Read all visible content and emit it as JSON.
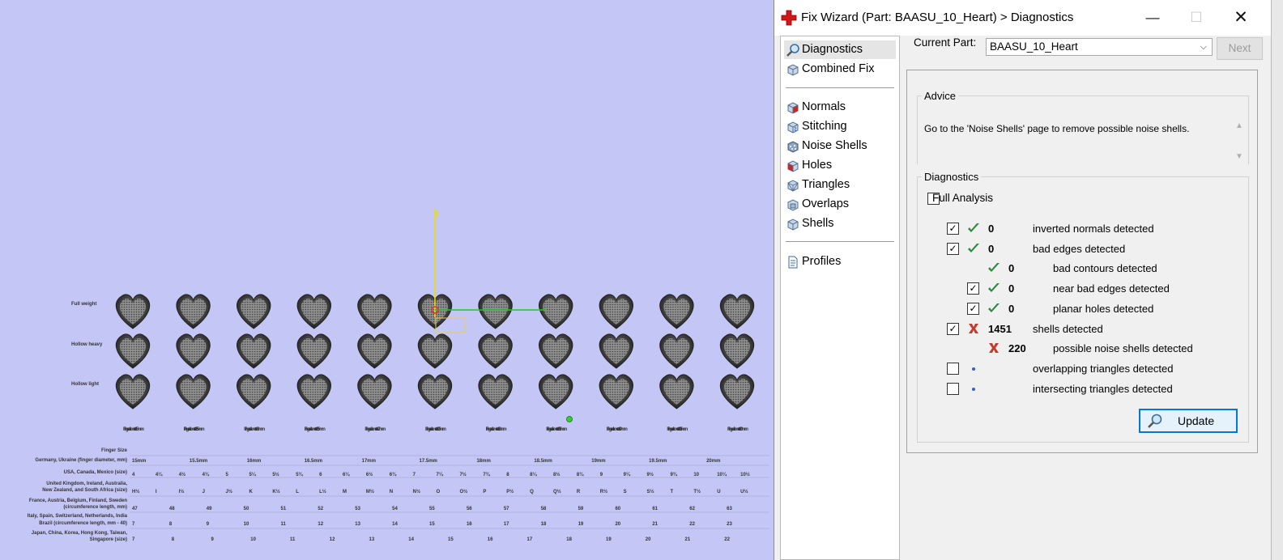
{
  "window": {
    "title": "Fix Wizard (Part: BAASU_10_Heart) > Diagnostics",
    "controls": {
      "minimize": "—",
      "maximize": "☐",
      "close": "✕"
    }
  },
  "nav": {
    "items": [
      {
        "label": "Diagnostics",
        "icon": "magnifier-icon",
        "selected": true
      },
      {
        "label": "Combined Fix",
        "icon": "cube-icon"
      },
      {
        "label": "Normals",
        "icon": "normals-cube-icon"
      },
      {
        "label": "Stitching",
        "icon": "stitching-cube-icon"
      },
      {
        "label": "Noise Shells",
        "icon": "noise-shells-icon"
      },
      {
        "label": "Holes",
        "icon": "holes-cube-icon"
      },
      {
        "label": "Triangles",
        "icon": "triangles-cube-icon"
      },
      {
        "label": "Overlaps",
        "icon": "overlaps-cube-icon"
      },
      {
        "label": "Shells",
        "icon": "shells-cube-icon"
      },
      {
        "label": "Profiles",
        "icon": "document-icon"
      }
    ]
  },
  "part": {
    "label": "Current Part:",
    "value": "BAASU_10_Heart",
    "next": "Next"
  },
  "advice": {
    "legend": "Advice",
    "text": "Go to the 'Noise Shells' page to remove possible noise shells."
  },
  "diagnostics": {
    "legend": "Diagnostics",
    "full_analysis": "Full Analysis",
    "rows": [
      {
        "checked": true,
        "status": "ok",
        "count": "0",
        "label": "inverted normals detected"
      },
      {
        "checked": true,
        "status": "ok",
        "count": "0",
        "label": "bad edges detected"
      },
      {
        "checkbox": false,
        "status": "ok",
        "count": "0",
        "label": "bad contours detected"
      },
      {
        "checked": true,
        "status": "ok",
        "count": "0",
        "label": "near bad edges detected"
      },
      {
        "checked": true,
        "status": "ok",
        "count": "0",
        "label": "planar holes detected"
      },
      {
        "checked": true,
        "status": "error",
        "count": "1451",
        "label": "shells detected"
      },
      {
        "checkbox": false,
        "status": "error",
        "count": "220",
        "label": "possible noise shells detected"
      },
      {
        "checked": false,
        "status": "none",
        "count": "",
        "label": "overlapping triangles detected"
      },
      {
        "checked": false,
        "status": "none",
        "count": "",
        "label": "intersecting triangles detected"
      }
    ],
    "update": "Update"
  },
  "viewport": {
    "axis_label": "y",
    "row_labels": [
      "Full weight",
      "Hollow heavy",
      "Hollow light"
    ],
    "finger_sizes": [
      "Finger diameter 15mm",
      "Finger diameter 15.5mm",
      "Finger diameter 16mm",
      "Finger diameter 16.5mm",
      "Finger diameter 17mm",
      "Finger diameter 17.5mm",
      "Finger diameter 18mm",
      "Finger diameter 18.5mm",
      "Finger diameter 19mm",
      "Finger diameter 19.5mm",
      "Finger diameter 20mm"
    ],
    "table_rows": [
      "Finger Size",
      "Germany, Ukraine (finger diameter, mm)",
      "USA, Canada, Mexico (size)",
      "United Kingdom, Ireland, Australia,",
      "New Zealand, and South Africa (size)",
      "France, Austria, Belgium, Finland, Sweden",
      "(circumference length, mm)",
      "Italy, Spain, Switzerland, Netherlands, India",
      "Brazil (circumference length, mm - 40)",
      "Japan, China, Korea, Hong Kong, Taiwan,",
      "Singapore (size)"
    ],
    "table_values": {
      "germany": [
        "15mm",
        "15.5mm",
        "16mm",
        "16.5mm",
        "17mm",
        "17.5mm",
        "18mm",
        "18.5mm",
        "19mm",
        "19.5mm",
        "20mm"
      ],
      "usa": [
        "4",
        "4¼",
        "4½",
        "4¾",
        "5",
        "5¼",
        "5½",
        "5¾",
        "6",
        "6¼",
        "6½",
        "6¾",
        "7",
        "7¼",
        "7½",
        "7¾",
        "8",
        "8¼",
        "8½",
        "8¾",
        "9",
        "9¼",
        "9½",
        "9¾",
        "10",
        "10¼",
        "10½"
      ],
      "uk": [
        "H½",
        "I",
        "I½",
        "J",
        "J½",
        "K",
        "K½",
        "L",
        "L½",
        "M",
        "M½",
        "N",
        "N½",
        "O",
        "O½",
        "P",
        "P½",
        "Q",
        "Q½",
        "R",
        "R½",
        "S",
        "S½",
        "T",
        "T½",
        "U",
        "U½"
      ],
      "france": [
        "47",
        "48",
        "49",
        "50",
        "51",
        "52",
        "53",
        "54",
        "55",
        "56",
        "57",
        "58",
        "59",
        "60",
        "61",
        "62",
        "63"
      ],
      "italy": [
        "7",
        "8",
        "9",
        "10",
        "11",
        "12",
        "13",
        "14",
        "15",
        "16",
        "17",
        "18",
        "19",
        "20",
        "21",
        "22",
        "23"
      ],
      "japan": [
        "7",
        "8",
        "9",
        "10",
        "11",
        "12",
        "13",
        "14",
        "15",
        "16",
        "17",
        "18",
        "19",
        "20",
        "21",
        "22"
      ]
    }
  }
}
